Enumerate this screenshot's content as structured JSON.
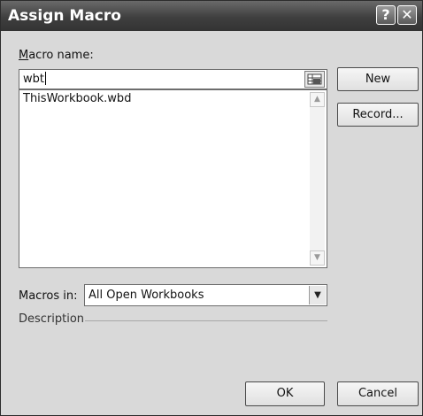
{
  "dialog": {
    "title": "Assign Macro",
    "help_button": "?",
    "close_button": "✕"
  },
  "macro_name": {
    "label": "Macro name:",
    "value": "wbt"
  },
  "macro_list": {
    "items": [
      "ThisWorkbook.wbd"
    ]
  },
  "buttons": {
    "new": "New",
    "record": "Record...",
    "ok": "OK",
    "cancel": "Cancel"
  },
  "macros_in": {
    "label": "Macros in:",
    "selected": "All Open Workbooks"
  },
  "description": {
    "label": "Description"
  }
}
